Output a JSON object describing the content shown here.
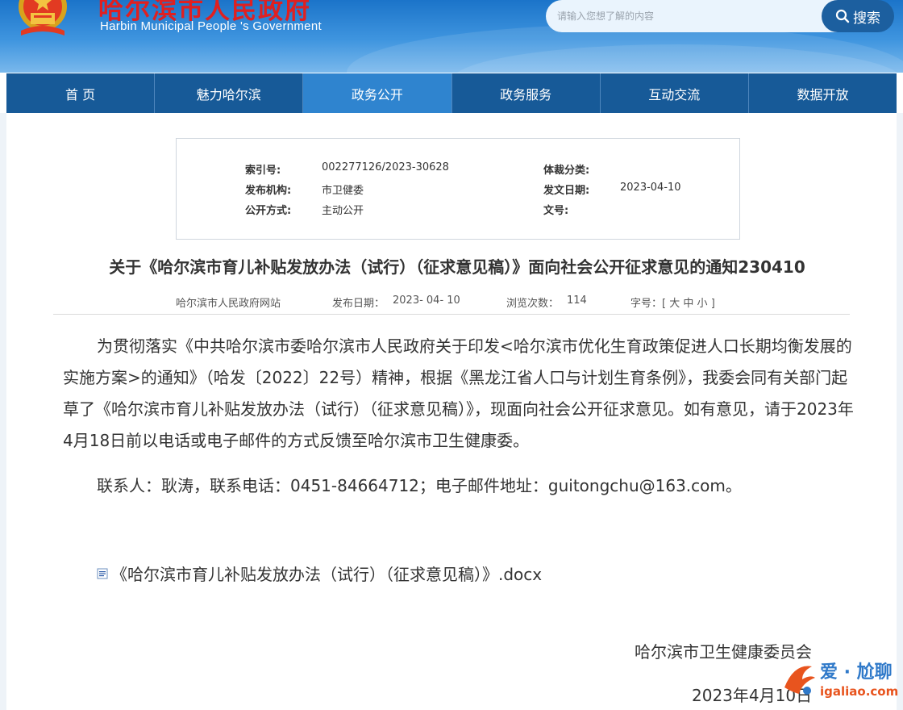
{
  "header": {
    "site_title": "哈尔滨市人民政府",
    "site_subtitle": "Harbin Municipal People 's Government",
    "search_placeholder": "请输入您想了解的内容",
    "search_button": "搜索"
  },
  "nav": {
    "items": [
      {
        "label": "首 页"
      },
      {
        "label": "魅力哈尔滨"
      },
      {
        "label": "政务公开"
      },
      {
        "label": "政务服务"
      },
      {
        "label": "互动交流"
      },
      {
        "label": "数据开放"
      }
    ]
  },
  "meta": {
    "index_label": "索引号:",
    "index_value": "002277126/2023-30628",
    "genre_label": "体裁分类:",
    "genre_value": "",
    "publisher_label": "发布机构:",
    "publisher_value": "市卫健委",
    "issue_date_label": "发文日期:",
    "issue_date_value": "2023-04-10",
    "disclosure_label": "公开方式:",
    "disclosure_value": "主动公开",
    "doc_no_label": "文号:",
    "doc_no_value": ""
  },
  "article": {
    "title": "关于《哈尔滨市育儿补贴发放办法（试行）（征求意见稿）》面向社会公开征求意见的通知230410",
    "source": "哈尔滨市人民政府网站",
    "publish_date_label": "发布日期：",
    "publish_date": "2023- 04- 10",
    "views_label": "浏览次数：",
    "views": "114",
    "font_size_label": "字号：[",
    "font_large": "大",
    "font_medium": "中",
    "font_small": "小",
    "font_size_close": "]",
    "paragraph1": "为贯彻落实《中共哈尔滨市委哈尔滨市人民政府关于印发<哈尔滨市优化生育政策促进人口长期均衡发展的实施方案>的通知》（哈发〔2022〕22号）精神，根据《黑龙江省人口与计划生育条例》，我委会同有关部门起草了《哈尔滨市育儿补贴发放办法（试行）（征求意见稿）》，现面向社会公开征求意见。如有意见，请于2023年4月18日前以电话或电子邮件的方式反馈至哈尔滨市卫生健康委。",
    "contact": "联系人：耿涛，联系电话：0451-84664712；电子邮件地址：guitongchu@163.com。",
    "attachment": "《哈尔滨市育儿补贴发放办法（试行）（征求意见稿）》.docx",
    "sign_org": "哈尔滨市卫生健康委员会",
    "sign_date": "2023年4月10日"
  },
  "watermark": {
    "text": "爱 · 尬聊",
    "url": "igaliao.com"
  },
  "colors": {
    "header_top": "#1b74c9",
    "nav_bg": "#175a98",
    "nav_active": "#2f84cf",
    "title_red": "#e02020",
    "search_button": "#1c5f9f"
  }
}
